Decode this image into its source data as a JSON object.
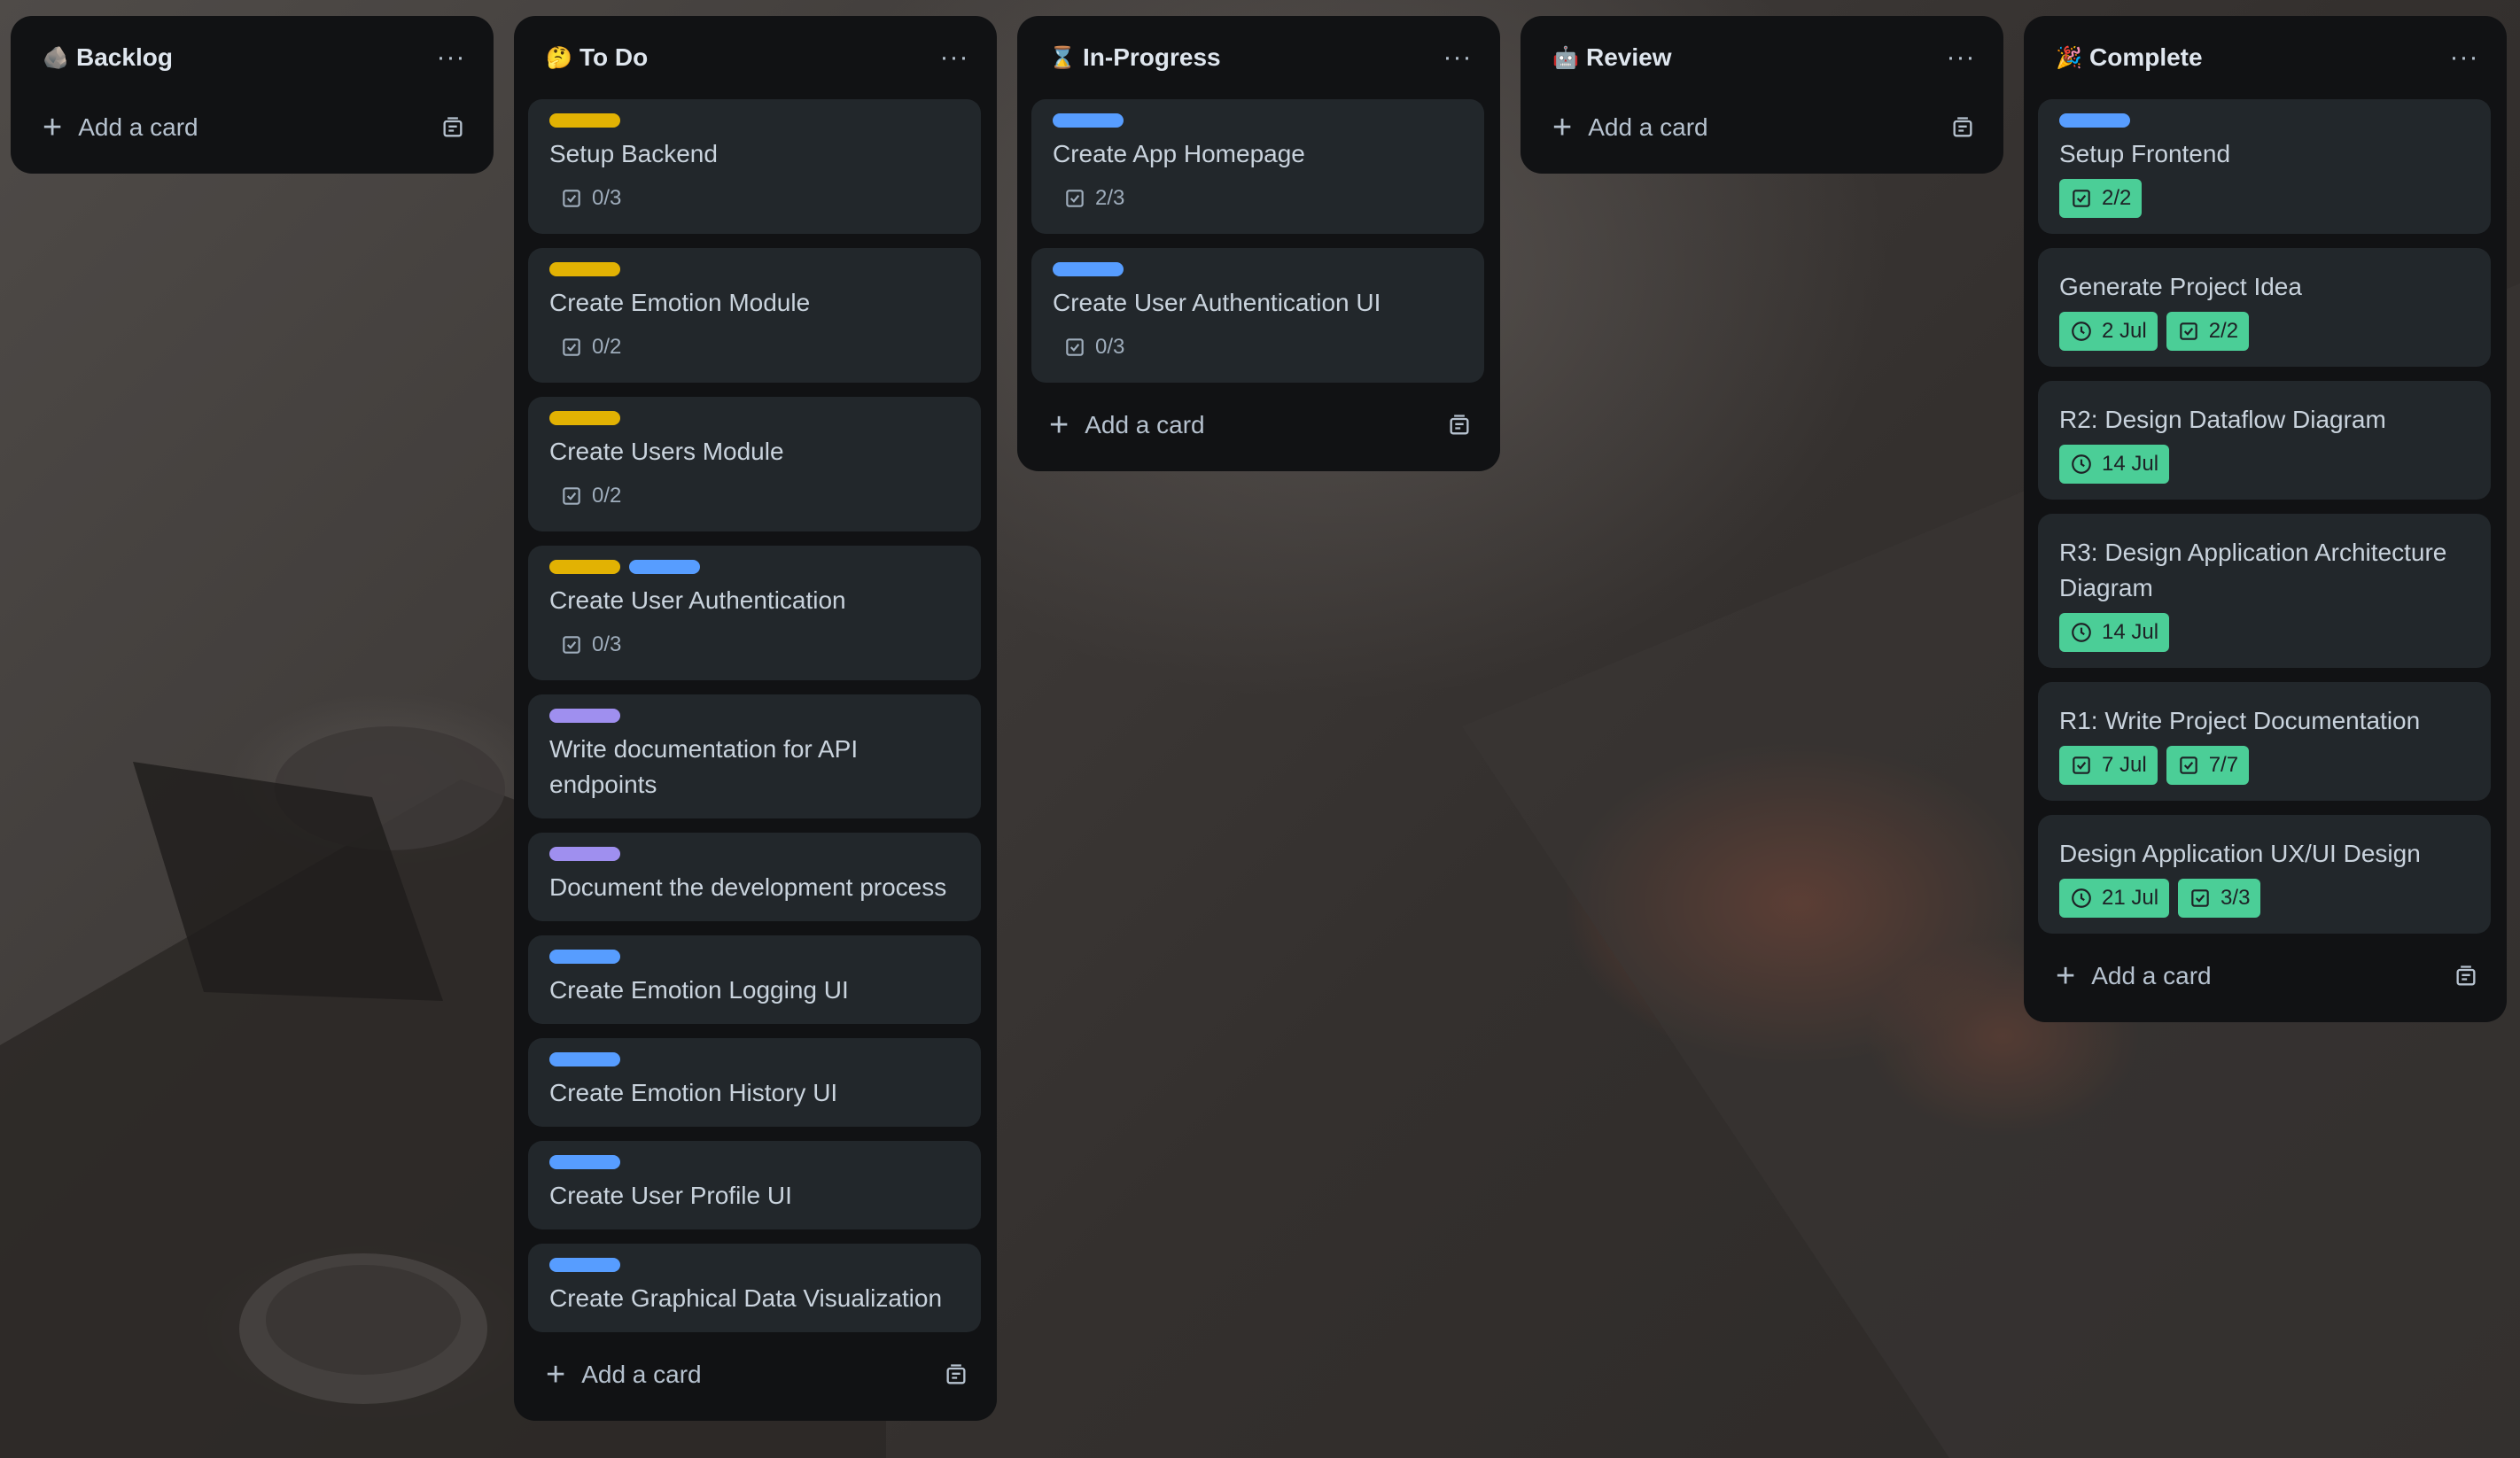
{
  "colors": {
    "yellow_label": "#e2b203",
    "blue_label": "#579dff",
    "purple_label": "#9f8fef",
    "green_badge": "#4bce97"
  },
  "lists": [
    {
      "title": "Backlog",
      "emoji": "🪨",
      "menu": "···",
      "add_label": "Add a card",
      "cards": []
    },
    {
      "title": "To Do",
      "emoji": "🤔",
      "menu": "···",
      "add_label": "Add a card",
      "cards": [
        {
          "title": "Setup Backend",
          "labels": [
            "yellow"
          ],
          "badges": [
            {
              "type": "checklist",
              "text": "0/3",
              "complete": false
            }
          ]
        },
        {
          "title": "Create Emotion Module",
          "labels": [
            "yellow"
          ],
          "badges": [
            {
              "type": "checklist",
              "text": "0/2",
              "complete": false
            }
          ]
        },
        {
          "title": "Create Users Module",
          "labels": [
            "yellow"
          ],
          "badges": [
            {
              "type": "checklist",
              "text": "0/2",
              "complete": false
            }
          ]
        },
        {
          "title": "Create User Authentication",
          "labels": [
            "yellow",
            "blue"
          ],
          "badges": [
            {
              "type": "checklist",
              "text": "0/3",
              "complete": false
            }
          ]
        },
        {
          "title": "Write documentation for API endpoints",
          "labels": [
            "purple"
          ],
          "badges": []
        },
        {
          "title": "Document the development process",
          "labels": [
            "purple"
          ],
          "badges": []
        },
        {
          "title": "Create Emotion Logging UI",
          "labels": [
            "blue"
          ],
          "badges": []
        },
        {
          "title": "Create Emotion History UI",
          "labels": [
            "blue"
          ],
          "badges": []
        },
        {
          "title": "Create User Profile UI",
          "labels": [
            "blue"
          ],
          "badges": []
        },
        {
          "title": "Create Graphical Data Visualization",
          "labels": [
            "blue"
          ],
          "badges": []
        }
      ]
    },
    {
      "title": "In-Progress",
      "emoji": "⌛",
      "menu": "···",
      "add_label": "Add a card",
      "cards": [
        {
          "title": "Create App Homepage",
          "labels": [
            "blue"
          ],
          "badges": [
            {
              "type": "checklist",
              "text": "2/3",
              "complete": false
            }
          ]
        },
        {
          "title": "Create User Authentication UI",
          "labels": [
            "blue"
          ],
          "badges": [
            {
              "type": "checklist",
              "text": "0/3",
              "complete": false
            }
          ]
        }
      ]
    },
    {
      "title": "Review",
      "emoji": "🤖",
      "menu": "···",
      "add_label": "Add a card",
      "cards": []
    },
    {
      "title": "Complete",
      "emoji": "🎉",
      "menu": "···",
      "add_label": "Add a card",
      "cards": [
        {
          "title": "Setup Frontend",
          "labels": [
            "blue"
          ],
          "badges": [
            {
              "type": "checklist",
              "text": "2/2",
              "complete": true
            }
          ]
        },
        {
          "title": "Generate Project Idea",
          "labels": [],
          "badges": [
            {
              "type": "due",
              "text": "2 Jul",
              "complete": true
            },
            {
              "type": "checklist",
              "text": "2/2",
              "complete": true
            }
          ]
        },
        {
          "title": "R2: Design Dataflow Diagram",
          "labels": [],
          "badges": [
            {
              "type": "due",
              "text": "14 Jul",
              "complete": true
            }
          ]
        },
        {
          "title": "R3: Design Application Architecture Diagram",
          "labels": [],
          "badges": [
            {
              "type": "due",
              "text": "14 Jul",
              "complete": true
            }
          ]
        },
        {
          "title": "R1: Write Project Documentation",
          "labels": [],
          "badges": [
            {
              "type": "checklist",
              "text": "7 Jul",
              "complete": true
            },
            {
              "type": "checklist",
              "text": "7/7",
              "complete": true
            }
          ]
        },
        {
          "title": "Design Application UX/UI Design",
          "labels": [],
          "badges": [
            {
              "type": "due",
              "text": "21 Jul",
              "complete": true
            },
            {
              "type": "checklist",
              "text": "3/3",
              "complete": true
            }
          ]
        }
      ]
    }
  ]
}
